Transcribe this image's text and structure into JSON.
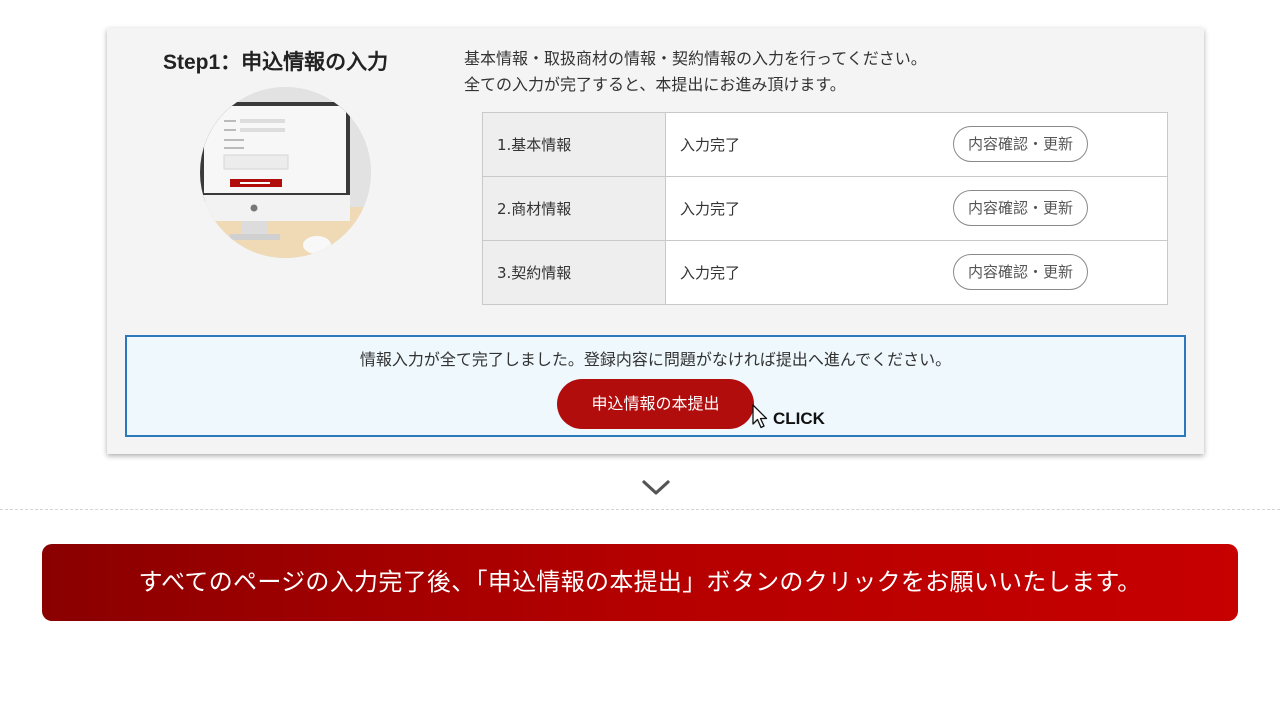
{
  "step": {
    "title": "Step1：申込情報の入力",
    "description": [
      "基本情報・取扱商材の情報・契約情報の入力を行ってください。",
      "全ての入力が完了すると、本提出にお進み頂けます。"
    ]
  },
  "table": {
    "rows": [
      {
        "label": "1.基本情報",
        "status": "入力完了",
        "button": "内容確認・更新"
      },
      {
        "label": "2.商材情報",
        "status": "入力完了",
        "button": "内容確認・更新"
      },
      {
        "label": "3.契約情報",
        "status": "入力完了",
        "button": "内容確認・更新"
      }
    ]
  },
  "submit": {
    "message": "情報入力が全て完了しました。登録内容に問題がなければ提出へ進んでください。",
    "button": "申込情報の本提出",
    "click_label": "CLICK"
  },
  "banner": {
    "text": "すべてのページの入力完了後、「申込情報の本提出」ボタンのクリックをお願いいたします。"
  },
  "colors": {
    "accent_red": "#b20d0d",
    "box_border_blue": "#2a79bb",
    "banner_dark": "#8a0000",
    "banner_light": "#c70000"
  }
}
